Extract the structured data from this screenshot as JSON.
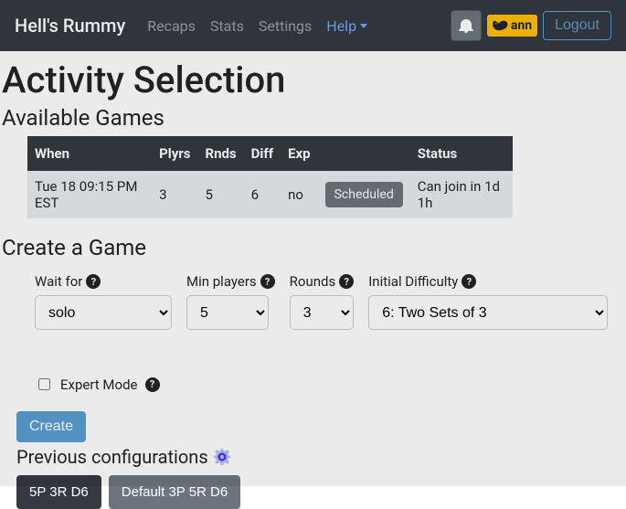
{
  "nav": {
    "brand": "Hell's Rummy",
    "links": {
      "recaps": "Recaps",
      "stats": "Stats",
      "settings": "Settings",
      "help": "Help"
    },
    "user": "ann",
    "logout": "Logout"
  },
  "titles": {
    "page": "Activity Selection",
    "available": "Available Games",
    "create": "Create a Game",
    "previous": "Previous configurations"
  },
  "games": {
    "headers": {
      "when": "When",
      "plyrs": "Plyrs",
      "rnds": "Rnds",
      "diff": "Diff",
      "exp": "Exp",
      "status": "Status"
    },
    "rows": [
      {
        "when": "Tue 18 09:15 PM EST",
        "plyrs": "3",
        "rnds": "5",
        "diff": "6",
        "exp": "no",
        "badge": "Scheduled",
        "status": "Can join in 1d 1h"
      }
    ]
  },
  "form": {
    "labels": {
      "waitfor": "Wait for",
      "minplayers": "Min players",
      "rounds": "Rounds",
      "initdiff": "Initial Difficulty",
      "expert": "Expert Mode",
      "create": "Create"
    },
    "values": {
      "waitfor": "solo",
      "minplayers": "5",
      "rounds": "3",
      "initdiff": "6: Two Sets of 3"
    }
  },
  "configs": [
    {
      "label": "5P 3R D6",
      "style": "dark"
    },
    {
      "label": "Default 3P 5R D6",
      "style": "grey"
    }
  ]
}
